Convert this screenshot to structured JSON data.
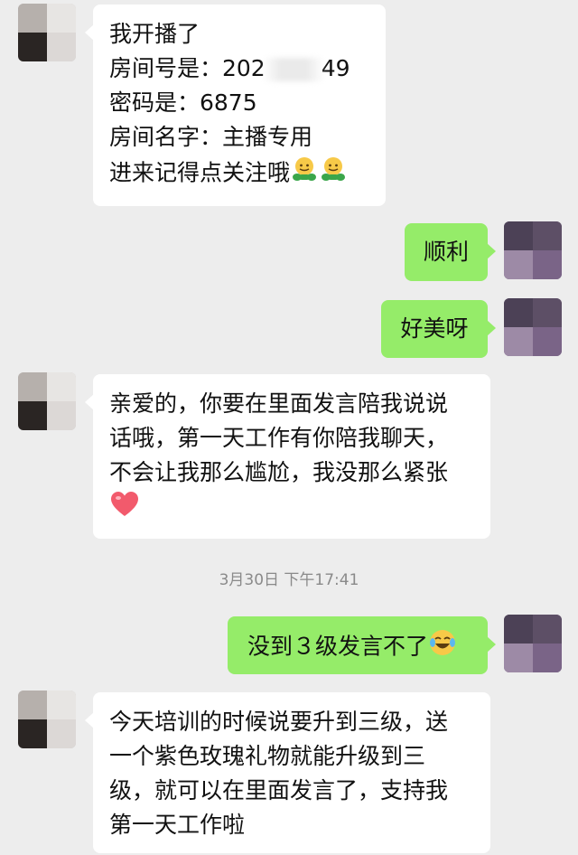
{
  "messages": [
    {
      "side": "left",
      "lines": [
        "我开播了",
        "房间号是：202",
        "49",
        "密码是：6875",
        "房间名字：主播专用",
        "进来记得点关注哦"
      ]
    },
    {
      "side": "right",
      "text": "顺利"
    },
    {
      "side": "right",
      "text": "好美呀"
    },
    {
      "side": "left",
      "lines": [
        "亲爱的，你要在里面发言陪我说说",
        "话哦，第一天工作有你陪我聊天，",
        "不会让我那么尴尬，我没那么紧张"
      ]
    },
    {
      "side": "right",
      "text": "没到３级发言不了"
    },
    {
      "side": "left",
      "lines": [
        "今天培训的时候说要升到三级，送",
        "一个紫色玫瑰礼物就能升级到三",
        "级，就可以在里面发言了，支持我",
        "第一天工作啦"
      ]
    }
  ],
  "timestamp": "3月30日 下午17:41",
  "colors": {
    "background": "#ededed",
    "self_bubble": "#95ec69",
    "other_bubble": "#ffffff",
    "timestamp_text": "#8a8a8a"
  },
  "icons": {
    "hug_emoji": "hug-emoji-icon",
    "heart_emoji": "heart-emoji-icon",
    "laugh_cry_emoji": "laughing-crying-emoji-icon"
  }
}
